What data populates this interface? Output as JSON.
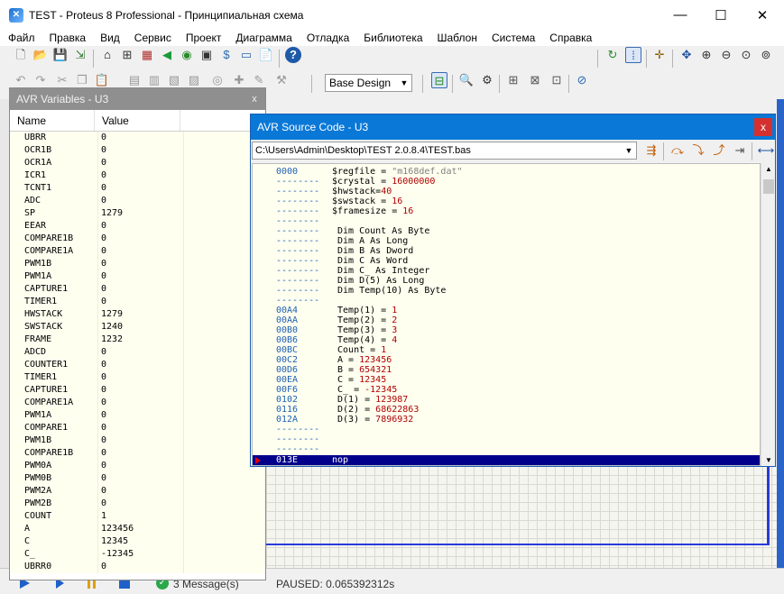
{
  "window": {
    "title": "TEST - Proteus 8 Professional - Принципиальная схема",
    "icon": "proteus-icon"
  },
  "menu": [
    "Файл",
    "Правка",
    "Вид",
    "Сервис",
    "Проект",
    "Диаграмма",
    "Отладка",
    "Библиотека",
    "Шаблон",
    "Система",
    "Справка"
  ],
  "toolbar": {
    "design_combo": "Base Design"
  },
  "variables_window": {
    "title": "AVR Variables - U3",
    "columns": [
      "Name",
      "Value"
    ],
    "rows": [
      {
        "name": "UBRR",
        "value": "0"
      },
      {
        "name": "OCR1B",
        "value": "0"
      },
      {
        "name": "OCR1A",
        "value": "0"
      },
      {
        "name": "ICR1",
        "value": "0"
      },
      {
        "name": "TCNT1",
        "value": "0"
      },
      {
        "name": "ADC",
        "value": "0"
      },
      {
        "name": "SP",
        "value": "1279"
      },
      {
        "name": "EEAR",
        "value": "0"
      },
      {
        "name": "COMPARE1B",
        "value": "0"
      },
      {
        "name": "COMPARE1A",
        "value": "0"
      },
      {
        "name": "PWM1B",
        "value": "0"
      },
      {
        "name": "PWM1A",
        "value": "0"
      },
      {
        "name": "CAPTURE1",
        "value": "0"
      },
      {
        "name": "TIMER1",
        "value": "0"
      },
      {
        "name": "HWSTACK",
        "value": "1279"
      },
      {
        "name": "SWSTACK",
        "value": "1240"
      },
      {
        "name": "FRAME",
        "value": "1232"
      },
      {
        "name": "ADCD",
        "value": "0"
      },
      {
        "name": "COUNTER1",
        "value": "0"
      },
      {
        "name": "TIMER1",
        "value": "0"
      },
      {
        "name": "CAPTURE1",
        "value": "0"
      },
      {
        "name": "COMPARE1A",
        "value": "0"
      },
      {
        "name": "PWM1A",
        "value": "0"
      },
      {
        "name": "COMPARE1",
        "value": "0"
      },
      {
        "name": "PWM1B",
        "value": "0"
      },
      {
        "name": "COMPARE1B",
        "value": "0"
      },
      {
        "name": "PWM0A",
        "value": "0"
      },
      {
        "name": "PWM0B",
        "value": "0"
      },
      {
        "name": "PWM2A",
        "value": "0"
      },
      {
        "name": "PWM2B",
        "value": "0"
      },
      {
        "name": "COUNT",
        "value": "1"
      },
      {
        "name": "A",
        "value": "123456"
      },
      {
        "name": "C",
        "value": "12345"
      },
      {
        "name": "C_",
        "value": "-12345"
      },
      {
        "name": "UBRR0",
        "value": "0"
      }
    ]
  },
  "source_window": {
    "title": "AVR Source Code - U3",
    "path": "C:\\Users\\Admin\\Desktop\\TEST 2.0.8.4\\TEST.bas",
    "lines": [
      {
        "addr": "0000",
        "code": "$regfile = \"m168def.dat\""
      },
      {
        "addr": "--------",
        "code": "$crystal = 16000000"
      },
      {
        "addr": "--------",
        "code": "$hwstack=40"
      },
      {
        "addr": "--------",
        "code": "$swstack = 16"
      },
      {
        "addr": "--------",
        "code": "$framesize = 16"
      },
      {
        "addr": "--------",
        "code": ""
      },
      {
        "addr": "--------",
        "code": " Dim Count As Byte"
      },
      {
        "addr": "--------",
        "code": " Dim A As Long"
      },
      {
        "addr": "--------",
        "code": " Dim B As Dword"
      },
      {
        "addr": "--------",
        "code": " Dim C As Word"
      },
      {
        "addr": "--------",
        "code": " Dim C_ As Integer"
      },
      {
        "addr": "--------",
        "code": " Dim D(5) As Long"
      },
      {
        "addr": "--------",
        "code": " Dim Temp(10) As Byte"
      },
      {
        "addr": "--------",
        "code": ""
      },
      {
        "addr": "00A4",
        "code": " Temp(1) = 1"
      },
      {
        "addr": "00AA",
        "code": " Temp(2) = 2"
      },
      {
        "addr": "00B0",
        "code": " Temp(3) = 3"
      },
      {
        "addr": "00B6",
        "code": " Temp(4) = 4"
      },
      {
        "addr": "00BC",
        "code": " Count = 1"
      },
      {
        "addr": "00C2",
        "code": " A = 123456"
      },
      {
        "addr": "00D6",
        "code": " B = 654321"
      },
      {
        "addr": "00EA",
        "code": " C = 12345"
      },
      {
        "addr": "00F6",
        "code": " C_ = -12345"
      },
      {
        "addr": "0102",
        "code": " D(1) = 123987"
      },
      {
        "addr": "0116",
        "code": " D(2) = 68622863"
      },
      {
        "addr": "012A",
        "code": " D(3) = 7896932"
      },
      {
        "addr": "--------",
        "code": ""
      },
      {
        "addr": "--------",
        "code": ""
      },
      {
        "addr": "--------",
        "code": ""
      }
    ],
    "current_line": {
      "addr": "013E",
      "code": "nop"
    }
  },
  "status": {
    "messages": "3 Message(s)",
    "paused": "PAUSED: 0.065392312s"
  },
  "colors": {
    "title_active": "#0a78d7",
    "title_inactive": "#8f8f8f",
    "code_bg": "#fffff0",
    "current_line": "#00008b",
    "address": "#1e60b4"
  }
}
